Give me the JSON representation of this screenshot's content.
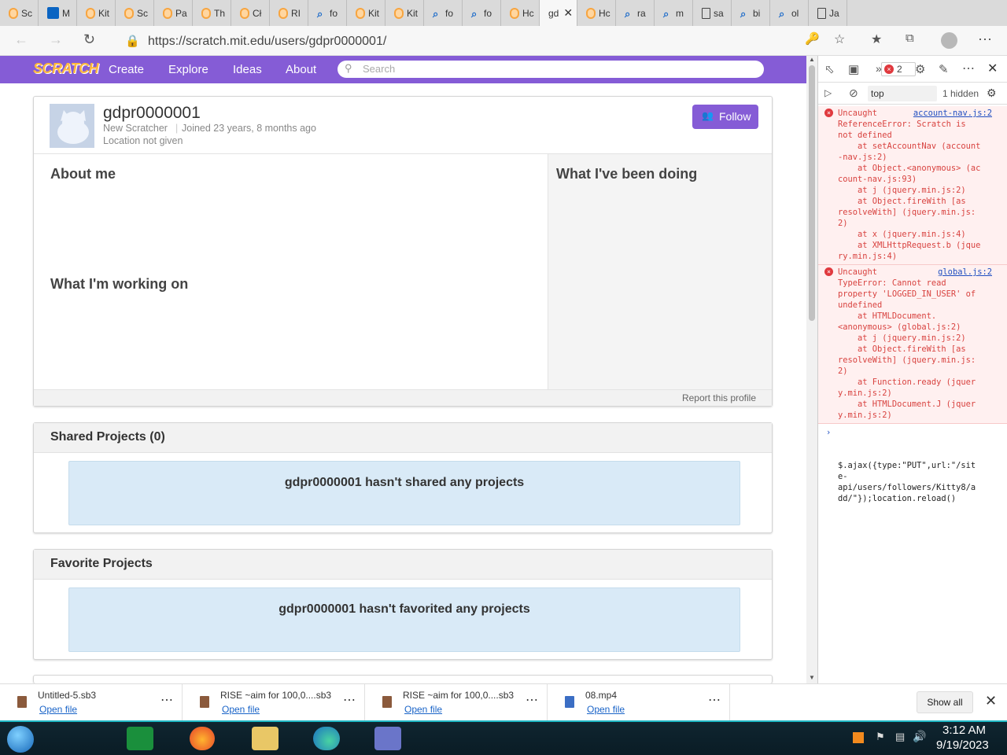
{
  "browser": {
    "tabs": [
      {
        "label": "Sc",
        "icon": "scratch-icon"
      },
      {
        "label": "M",
        "icon": "outlook-icon"
      },
      {
        "label": "Kit",
        "icon": "scratch-icon"
      },
      {
        "label": "Sc",
        "icon": "scratch-icon"
      },
      {
        "label": "Pa",
        "icon": "scratch-icon"
      },
      {
        "label": "Th",
        "icon": "scratch-icon"
      },
      {
        "label": "Cł",
        "icon": "scratch-icon"
      },
      {
        "label": "RI",
        "icon": "scratch-icon"
      },
      {
        "label": "fo",
        "icon": "search-icon"
      },
      {
        "label": "Kit",
        "icon": "scratch-icon"
      },
      {
        "label": "Kit",
        "icon": "scratch-icon"
      },
      {
        "label": "fo",
        "icon": "search-icon"
      },
      {
        "label": "fo",
        "icon": "search-icon"
      },
      {
        "label": "Hc",
        "icon": "scratch-icon"
      },
      {
        "label": "gd",
        "icon": "none",
        "active": true
      },
      {
        "label": "Hc",
        "icon": "scratch-icon"
      },
      {
        "label": "ra",
        "icon": "search-icon"
      },
      {
        "label": "m",
        "icon": "search-icon"
      },
      {
        "label": "sa",
        "icon": "page-icon"
      },
      {
        "label": "bi",
        "icon": "search-icon"
      },
      {
        "label": "ol",
        "icon": "search-icon"
      },
      {
        "label": "Ja",
        "icon": "page-icon"
      }
    ],
    "url": "https://scratch.mit.edu/users/gdpr0000001/"
  },
  "scratch_nav": {
    "logo": "SCRATCH",
    "links": [
      "Create",
      "Explore",
      "Ideas",
      "About"
    ],
    "search_placeholder": "Search"
  },
  "profile": {
    "username": "gdpr0000001",
    "rank": "New Scratcher",
    "joined": "Joined 23 years, 8 months ago",
    "location": "Location not given",
    "follow_label": "Follow",
    "about_me_title": "About me",
    "working_on_title": "What I'm working on",
    "doing_title": "What I've been doing",
    "report_label": "Report this profile"
  },
  "sections": {
    "shared_title": "Shared Projects (0)",
    "shared_empty": "gdpr0000001 hasn't shared any projects",
    "favorite_title": "Favorite Projects",
    "favorite_empty": "gdpr0000001 hasn't favorited any projects"
  },
  "devtools": {
    "error_count": "2",
    "context": "top",
    "hidden": "1 hidden",
    "errors": [
      {
        "head": "Uncaught",
        "source": "account-nav.js:2",
        "lines": [
          "ReferenceError: Scratch is",
          "not defined",
          "    at setAccountNav (account",
          "-nav.js:2)",
          "    at Object.<anonymous> (ac",
          "count-nav.js:93)",
          "    at j (jquery.min.js:2)",
          "    at Object.fireWith [as",
          "resolveWith] (jquery.min.js:",
          "2)",
          "    at x (jquery.min.js:4)",
          "    at XMLHttpRequest.b (jque",
          "ry.min.js:4)"
        ]
      },
      {
        "head": "Uncaught",
        "source": "global.js:2",
        "lines": [
          "TypeError: Cannot read",
          "property 'LOGGED_IN_USER' of",
          "undefined",
          "    at HTMLDocument.",
          "<anonymous> (global.js:2)",
          "    at j (jquery.min.js:2)",
          "    at Object.fireWith [as",
          "resolveWith] (jquery.min.js:",
          "2)",
          "    at Function.ready (jquer",
          "y.min.js:2)",
          "    at HTMLDocument.J (jquer",
          "y.min.js:2)"
        ]
      }
    ],
    "console_input": [
      "$.ajax({type:\"PUT\",url:\"/sit",
      "e-",
      "api/users/followers/Kitty8/a",
      "dd/\"});location.reload()"
    ]
  },
  "downloads": {
    "items": [
      {
        "name": "Untitled-5.sb3",
        "action": "Open file"
      },
      {
        "name": "RISE ~aim for 100,0....sb3",
        "action": "Open file"
      },
      {
        "name": "RISE ~aim for 100,0....sb3",
        "action": "Open file"
      },
      {
        "name": "08.mp4",
        "action": "Open file"
      }
    ],
    "show_all": "Show all"
  },
  "taskbar": {
    "time": "3:12 AM",
    "date": "9/19/2023"
  }
}
